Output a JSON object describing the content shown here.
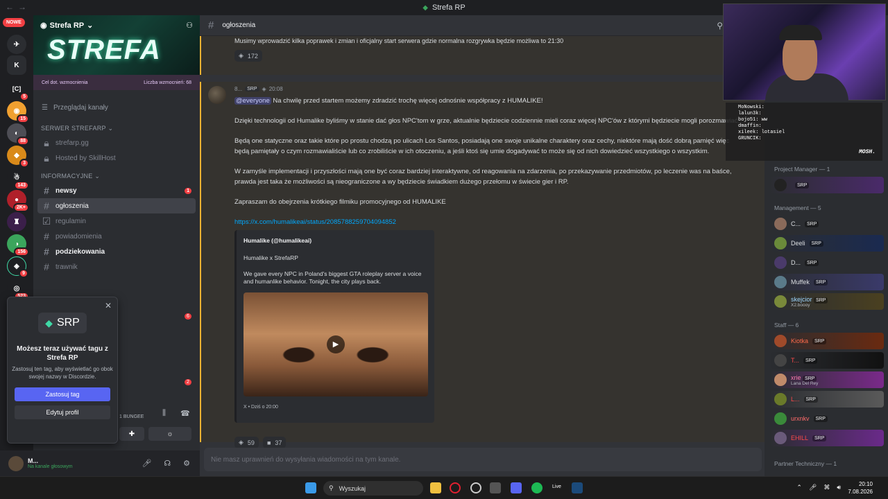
{
  "window": {
    "title": "Strefa RP"
  },
  "rail": {
    "nowe": "NOWE",
    "badges": [
      "5",
      "15",
      "88",
      "3",
      "143",
      "2K+",
      "",
      "156",
      "9",
      "523"
    ]
  },
  "server": {
    "name": "Strefa RP",
    "banner_text": "STREFA",
    "boost_goal": "Cel dot. wzmocnienia",
    "boost_count": "Liczba wzmocnień: 68",
    "browse": "Przeglądaj kanały",
    "cat1": "SERWER STREFARP",
    "cat2": "INFORMACYJNE",
    "channels1": [
      {
        "name": "strefarp.gg"
      },
      {
        "name": "Hosted by SkillHost"
      }
    ],
    "channels2": [
      {
        "name": "newsy",
        "badge": "1"
      },
      {
        "name": "ogłoszenia",
        "badge": ""
      },
      {
        "name": "regulamin",
        "badge": ""
      },
      {
        "name": "powiadomienia",
        "badge": ""
      },
      {
        "name": "podziekowania",
        "badge": ""
      },
      {
        "name": "trawnik",
        "badge": ""
      }
    ],
    "extra_badges": [
      "6",
      "2"
    ]
  },
  "popup": {
    "tag_label": "SRP",
    "title": "Możesz teraz używać tagu z Strefa RP",
    "desc": "Zastosuj ten tag, aby wyświetlać go obok swojej nazwy w Discordzie.",
    "apply": "Zastosuj tag",
    "edit": "Edytuj profil"
  },
  "voice": {
    "channel": "1 BUNGEE"
  },
  "user": {
    "name": "M...",
    "status": "Na kanale głosowym"
  },
  "chat": {
    "channel": "ogłoszenia",
    "prev_text": "Musimy wprowadzić kilka poprawek i zmian i oficjalny start serwera gdzie normalna rozgrywka będzie możliwa to 21:30",
    "prev_reaction": "172",
    "author": "8...",
    "author_tag": "SRP",
    "time": "20:08",
    "mention": "@everyone",
    "p1": "Na chwilę przed startem możemy zdradzić trochę więcej odnośnie współpracy z HUMALIKE!",
    "p2": "Dzięki technologii od Humalike byliśmy w stanie dać głos NPC'tom w grze, aktualnie będziecie codziennie mieli coraz więcej NPC'ów z którymi będziecie mogli porozmawiać.",
    "p3": "Będą one statyczne oraz takie które po prostu chodzą po ulicach Los Santos, posiadają one swoje unikalne charaktery oraz cechy, niektóre mają dość dobrą pamięć więc będą pamiętały o czym rozmawialiście lub co zrobiliście w ich otoczeniu, a jeśli ktoś się umie dogadywać to może się od nich dowiedzieć wszystkiego o wszystkim.",
    "p4": "W zamyśle implementacji i przyszłości mają one być coraz bardziej interaktywne, od reagowania na zdarzenia, po przekazywanie przedmiotów, po leczenie was na baśce, prawda jest taka że możliwości są nieograniczone a wy będziecie świadkiem dużego przełomu w świecie gier i RP.",
    "p5": "Zapraszam do obejrzenia krótkiego filmiku promocyjnego od HUMALIKE",
    "link": "https://x.com/humalikeai/status/2085788259704094852",
    "embed_author": "Humalike (@humalikeai)",
    "embed_title": "Humalike x StrefaRP",
    "embed_desc": "We gave every NPC in Poland's biggest GTA roleplay server a voice and humanlike behavior. Tonight, the city plays back.",
    "embed_footer": "X • Dziś o 20:00",
    "reaction1": "59",
    "reaction2": "37",
    "input_placeholder": "Nie masz uprawnień do wysyłania wiadomości na tym kanale."
  },
  "stream_chat": [
    "MoNowski: ",
    "lalun3k: ",
    "bojo51: ww",
    "dmaffin: ",
    "xileek: lotasiel",
    "GRUNCIK: "
  ],
  "stream_logo": "MOSH.",
  "members": {
    "cat_pm": "Project Manager — 1",
    "cat_mgmt": "Management — 5",
    "cat_staff": "Staff — 6",
    "cat_partner": "Partner Techniczny — 1",
    "pm": [
      {
        "name": "",
        "tag": "SRP",
        "sub": ""
      }
    ],
    "mgmt": [
      {
        "name": "C...",
        "tag": "SRP",
        "sub": ""
      },
      {
        "name": "Deeli",
        "tag": "SRP",
        "sub": ""
      },
      {
        "name": "D...",
        "tag": "SRP",
        "sub": ""
      },
      {
        "name": "Muffek",
        "tag": "SRP",
        "sub": ""
      },
      {
        "name": "skejcior",
        "tag": "SRP",
        "sub": "X2.boooy"
      }
    ],
    "staff": [
      {
        "name": "Kiotka",
        "tag": "SRP",
        "sub": ""
      },
      {
        "name": "T...",
        "tag": "SRP",
        "sub": ""
      },
      {
        "name": "xrie",
        "tag": "SRP",
        "sub": "Lana Del Rey"
      },
      {
        "name": "L...",
        "tag": "SRP",
        "sub": ""
      },
      {
        "name": "urxnkv",
        "tag": "SRP",
        "sub": ""
      },
      {
        "name": "EHILL",
        "tag": "SRP",
        "sub": ""
      }
    ]
  },
  "taskbar": {
    "search": "Wyszukaj",
    "time": "20:10",
    "date": "7.08.2026",
    "live": "Live"
  },
  "colors": {
    "accent": "#5865f2",
    "unread_bar": "#f0b232",
    "link": "#00a8fc"
  }
}
